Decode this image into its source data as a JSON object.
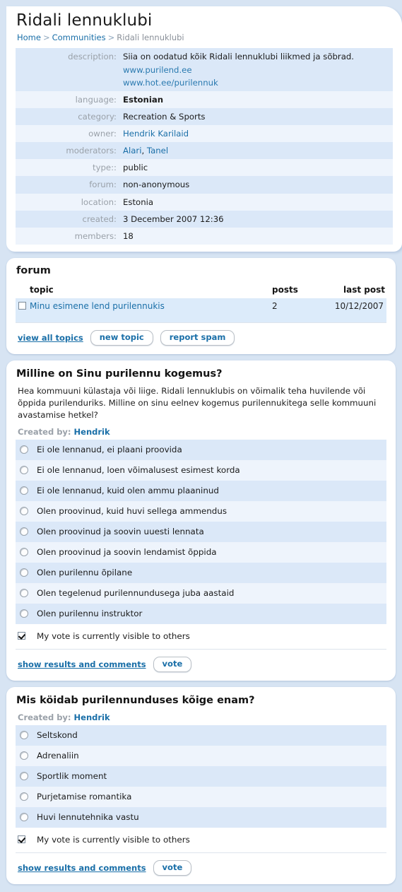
{
  "header": {
    "title": "Ridali lennuklubi",
    "breadcrumb": {
      "home": "Home",
      "sep1": ">",
      "communities": "Communities",
      "sep2": ">",
      "current": "Ridali lennuklubi"
    }
  },
  "details": {
    "rows": [
      {
        "label": "description:",
        "value": "Siia on oodatud kõik Ridali lennuklubi liikmed ja sõbrad.",
        "links": [
          "www.purilend.ee",
          "www.hot.ee/purilennuk"
        ],
        "bold": false
      },
      {
        "label": "language:",
        "value": "Estonian",
        "bold": true
      },
      {
        "label": "category:",
        "value": "Recreation & Sports",
        "bold": false
      },
      {
        "label": "owner:",
        "value": "Hendrik Karilaid",
        "link": true
      },
      {
        "label": "moderators:",
        "value": "Alari, Tanel",
        "link": true,
        "link_parts": [
          "Alari",
          "Tanel"
        ]
      },
      {
        "label": "type::",
        "value": "public",
        "bold": false
      },
      {
        "label": "forum:",
        "value": "non-anonymous",
        "bold": false
      },
      {
        "label": "location:",
        "value": "Estonia",
        "bold": false
      },
      {
        "label": "created:",
        "value": "3 December 2007 12:36",
        "bold": false
      },
      {
        "label": "members:",
        "value": "18",
        "bold": false
      }
    ]
  },
  "forum": {
    "heading": "forum",
    "columns": {
      "topic": "topic",
      "posts": "posts",
      "last_post": "last post"
    },
    "topics": [
      {
        "title": "Minu esimene lend purilennukis",
        "posts": "2",
        "last_post": "10/12/2007",
        "checked": false
      }
    ],
    "actions": {
      "view_all": "view all topics",
      "new_topic": "new topic",
      "report_spam": "report spam"
    }
  },
  "polls": [
    {
      "title": "Milline on Sinu purilennu kogemus?",
      "description": "Hea kommuuni külastaja või liige. Ridali lennuklubis on võimalik teha huvilende või õppida purilenduriks. Milline on sinu eelnev kogemus purilennukitega selle kommuuni avastamise hetkel?",
      "created_by_label": "Created by:",
      "created_by": "Hendrik",
      "options": [
        "Ei ole lennanud, ei plaani proovida",
        "Ei ole lennanud, loen võimalusest esimest korda",
        "Ei ole lennanud, kuid olen ammu plaaninud",
        "Olen proovinud, kuid huvi sellega ammendus",
        "Olen proovinud ja soovin uuesti lennata",
        "Olen proovinud ja soovin lendamist õppida",
        "Olen purilennu õpilane",
        "Olen tegelenud purilennundusega juba aastaid",
        "Olen purilennu instruktor"
      ],
      "visibility_label": "My vote is currently visible to others",
      "visibility_checked": true,
      "show_results": "show results and comments",
      "vote": "vote"
    },
    {
      "title": "Mis köidab purilennunduses kõige enam?",
      "description": "",
      "created_by_label": "Created by:",
      "created_by": "Hendrik",
      "options": [
        "Seltskond",
        "Adrenaliin",
        "Sportlik moment",
        "Purjetamise romantika",
        "Huvi lennutehnika vastu"
      ],
      "visibility_label": "My vote is currently visible to others",
      "visibility_checked": true,
      "show_results": "show results and comments",
      "vote": "vote"
    }
  ],
  "colors": {
    "page_background": "#d7e4f3",
    "panel_background": "#ffffff",
    "link": "#1a6fa8",
    "row_odd": "#dbe8f8",
    "row_even": "#eef4fc",
    "label_text": "#9aa1a9"
  }
}
